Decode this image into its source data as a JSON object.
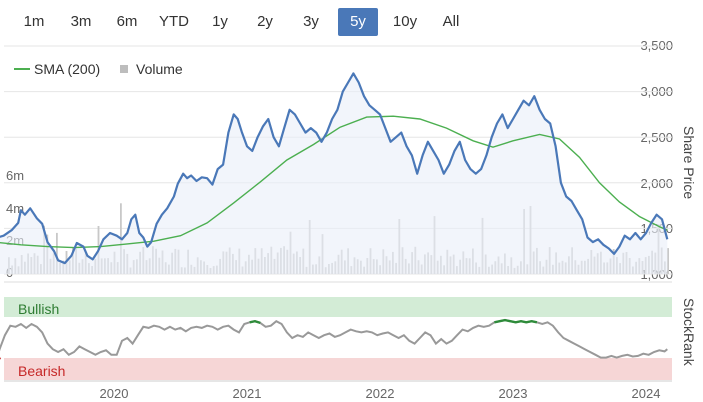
{
  "range_selector": {
    "buttons": [
      "1m",
      "3m",
      "6m",
      "YTD",
      "1y",
      "2y",
      "3y",
      "5y",
      "10y",
      "All"
    ],
    "selected": "5y"
  },
  "colors": {
    "price": "#4a78b8",
    "sma": "#4caf50",
    "volume": "#c8c8c8",
    "bullish_band": "#d3ecd6",
    "bearish_band": "#f6d6d6",
    "stockrank_line": "#999999",
    "stockrank_bull": "#2e8b3a",
    "stockrank_bear": "#c62828"
  },
  "chart_data": {
    "type": "line",
    "legend": [
      "SMA (200)",
      "Volume"
    ],
    "y_right": {
      "title": "Share Price",
      "ticks": [
        "1,000",
        "1,500",
        "2,000",
        "2,500",
        "3,000",
        "3,500"
      ],
      "ylim": [
        1000,
        3500
      ]
    },
    "y_left": {
      "ticks": [
        "0",
        "2m",
        "4m",
        "6m"
      ],
      "ylim": [
        0,
        10
      ]
    },
    "x_ticks": [
      "2020",
      "2021",
      "2022",
      "2023",
      "2024"
    ],
    "series": [
      {
        "name": "",
        "points": [
          [
            2019.1,
            1390
          ],
          [
            2019.17,
            1420
          ],
          [
            2019.23,
            1480
          ],
          [
            2019.28,
            1560
          ],
          [
            2019.3,
            1700
          ],
          [
            2019.33,
            1650
          ],
          [
            2019.37,
            1720
          ],
          [
            2019.42,
            1610
          ],
          [
            2019.46,
            1550
          ],
          [
            2019.5,
            1350
          ],
          [
            2019.55,
            1250
          ],
          [
            2019.58,
            1150
          ],
          [
            2019.63,
            1120
          ],
          [
            2019.68,
            1200
          ],
          [
            2019.72,
            1340
          ],
          [
            2019.77,
            1300
          ],
          [
            2019.8,
            1200
          ],
          [
            2019.84,
            1160
          ],
          [
            2019.88,
            1250
          ],
          [
            2019.92,
            1380
          ],
          [
            2019.97,
            1450
          ],
          [
            2020.02,
            1420
          ],
          [
            2020.06,
            1380
          ],
          [
            2020.1,
            1450
          ],
          [
            2020.13,
            1600
          ],
          [
            2020.16,
            1650
          ],
          [
            2020.19,
            1450
          ],
          [
            2020.22,
            1400
          ],
          [
            2020.25,
            1300
          ],
          [
            2020.28,
            1350
          ],
          [
            2020.32,
            1550
          ],
          [
            2020.36,
            1650
          ],
          [
            2020.4,
            1720
          ],
          [
            2020.45,
            1850
          ],
          [
            2020.48,
            1990
          ],
          [
            2020.52,
            2100
          ],
          [
            2020.55,
            2050
          ],
          [
            2020.58,
            2080
          ],
          [
            2020.62,
            2020
          ],
          [
            2020.66,
            2060
          ],
          [
            2020.7,
            2050
          ],
          [
            2020.74,
            1980
          ],
          [
            2020.78,
            2150
          ],
          [
            2020.82,
            2200
          ],
          [
            2020.86,
            2550
          ],
          [
            2020.9,
            2750
          ],
          [
            2020.93,
            2700
          ],
          [
            2020.96,
            2560
          ],
          [
            2021.0,
            2400
          ],
          [
            2021.04,
            2350
          ],
          [
            2021.08,
            2500
          ],
          [
            2021.12,
            2620
          ],
          [
            2021.16,
            2700
          ],
          [
            2021.2,
            2500
          ],
          [
            2021.24,
            2400
          ],
          [
            2021.28,
            2600
          ],
          [
            2021.32,
            2800
          ],
          [
            2021.36,
            2750
          ],
          [
            2021.4,
            2650
          ],
          [
            2021.44,
            2550
          ],
          [
            2021.48,
            2600
          ],
          [
            2021.52,
            2550
          ],
          [
            2021.56,
            2450
          ],
          [
            2021.6,
            2550
          ],
          [
            2021.64,
            2700
          ],
          [
            2021.68,
            2800
          ],
          [
            2021.72,
            3000
          ],
          [
            2021.76,
            3100
          ],
          [
            2021.8,
            3200
          ],
          [
            2021.84,
            3100
          ],
          [
            2021.88,
            2950
          ],
          [
            2021.92,
            2850
          ],
          [
            2021.96,
            2800
          ],
          [
            2022.0,
            2750
          ],
          [
            2022.04,
            2600
          ],
          [
            2022.08,
            2450
          ],
          [
            2022.12,
            2500
          ],
          [
            2022.16,
            2550
          ],
          [
            2022.2,
            2400
          ],
          [
            2022.24,
            2300
          ],
          [
            2022.28,
            2100
          ],
          [
            2022.32,
            2300
          ],
          [
            2022.36,
            2450
          ],
          [
            2022.4,
            2350
          ],
          [
            2022.44,
            2250
          ],
          [
            2022.48,
            2100
          ],
          [
            2022.52,
            2200
          ],
          [
            2022.56,
            2350
          ],
          [
            2022.6,
            2450
          ],
          [
            2022.64,
            2250
          ],
          [
            2022.68,
            2150
          ],
          [
            2022.72,
            2100
          ],
          [
            2022.76,
            2150
          ],
          [
            2022.8,
            2300
          ],
          [
            2022.84,
            2500
          ],
          [
            2022.88,
            2650
          ],
          [
            2022.92,
            2750
          ],
          [
            2022.96,
            2600
          ],
          [
            2023.0,
            2700
          ],
          [
            2023.04,
            2800
          ],
          [
            2023.08,
            2900
          ],
          [
            2023.12,
            2850
          ],
          [
            2023.16,
            2950
          ],
          [
            2023.2,
            2800
          ],
          [
            2023.24,
            2700
          ],
          [
            2023.28,
            2650
          ],
          [
            2023.32,
            2400
          ],
          [
            2023.36,
            2000
          ],
          [
            2023.4,
            1850
          ],
          [
            2023.44,
            1800
          ],
          [
            2023.48,
            1700
          ],
          [
            2023.52,
            1600
          ],
          [
            2023.56,
            1400
          ],
          [
            2023.6,
            1350
          ],
          [
            2023.64,
            1380
          ],
          [
            2023.68,
            1320
          ],
          [
            2023.72,
            1280
          ],
          [
            2023.76,
            1220
          ],
          [
            2023.8,
            1300
          ],
          [
            2023.84,
            1420
          ],
          [
            2023.88,
            1380
          ],
          [
            2023.92,
            1450
          ],
          [
            2023.96,
            1380
          ],
          [
            2024.0,
            1450
          ],
          [
            2024.04,
            1560
          ],
          [
            2024.08,
            1650
          ],
          [
            2024.12,
            1600
          ],
          [
            2024.16,
            1380
          ]
        ]
      },
      {
        "name": "SMA (200)",
        "points": [
          [
            2019.1,
            1350
          ],
          [
            2019.3,
            1320
          ],
          [
            2019.5,
            1300
          ],
          [
            2019.7,
            1290
          ],
          [
            2019.9,
            1300
          ],
          [
            2020.1,
            1330
          ],
          [
            2020.3,
            1360
          ],
          [
            2020.5,
            1420
          ],
          [
            2020.7,
            1560
          ],
          [
            2020.9,
            1780
          ],
          [
            2021.1,
            2010
          ],
          [
            2021.3,
            2250
          ],
          [
            2021.5,
            2420
          ],
          [
            2021.7,
            2610
          ],
          [
            2021.9,
            2720
          ],
          [
            2022.1,
            2730
          ],
          [
            2022.3,
            2700
          ],
          [
            2022.5,
            2600
          ],
          [
            2022.7,
            2460
          ],
          [
            2022.85,
            2390
          ],
          [
            2023.0,
            2460
          ],
          [
            2023.2,
            2530
          ],
          [
            2023.35,
            2480
          ],
          [
            2023.5,
            2280
          ],
          [
            2023.65,
            2000
          ],
          [
            2023.8,
            1790
          ],
          [
            2023.95,
            1630
          ],
          [
            2024.1,
            1520
          ],
          [
            2024.16,
            1480
          ]
        ]
      }
    ],
    "stockrank": {
      "title": "StockRank",
      "bands": [
        "Bullish",
        "Bearish"
      ],
      "ylim": [
        0,
        100
      ],
      "points": [
        [
          2019.1,
          0
        ],
        [
          2019.14,
          30
        ],
        [
          2019.18,
          55
        ],
        [
          2019.22,
          72
        ],
        [
          2019.26,
          70
        ],
        [
          2019.3,
          75
        ],
        [
          2019.34,
          68
        ],
        [
          2019.38,
          75
        ],
        [
          2019.42,
          70
        ],
        [
          2019.46,
          60
        ],
        [
          2019.5,
          40
        ],
        [
          2019.54,
          30
        ],
        [
          2019.58,
          25
        ],
        [
          2019.62,
          30
        ],
        [
          2019.66,
          20
        ],
        [
          2019.7,
          25
        ],
        [
          2019.74,
          35
        ],
        [
          2019.78,
          30
        ],
        [
          2019.82,
          25
        ],
        [
          2019.86,
          20
        ],
        [
          2019.9,
          25
        ],
        [
          2019.94,
          28
        ],
        [
          2019.98,
          20
        ],
        [
          2020.02,
          20
        ],
        [
          2020.06,
          45
        ],
        [
          2020.1,
          50
        ],
        [
          2020.14,
          40
        ],
        [
          2020.18,
          55
        ],
        [
          2020.22,
          70
        ],
        [
          2020.26,
          68
        ],
        [
          2020.3,
          72
        ],
        [
          2020.34,
          70
        ],
        [
          2020.38,
          65
        ],
        [
          2020.42,
          70
        ],
        [
          2020.46,
          65
        ],
        [
          2020.5,
          68
        ],
        [
          2020.54,
          62
        ],
        [
          2020.58,
          68
        ],
        [
          2020.62,
          70
        ],
        [
          2020.66,
          68
        ],
        [
          2020.7,
          72
        ],
        [
          2020.74,
          70
        ],
        [
          2020.78,
          65
        ],
        [
          2020.82,
          70
        ],
        [
          2020.86,
          72
        ],
        [
          2020.9,
          65
        ],
        [
          2020.94,
          60
        ],
        [
          2020.98,
          75
        ],
        [
          2021.02,
          78
        ],
        [
          2021.06,
          80
        ],
        [
          2021.1,
          77
        ],
        [
          2021.14,
          70
        ],
        [
          2021.18,
          72
        ],
        [
          2021.22,
          80
        ],
        [
          2021.26,
          75
        ],
        [
          2021.3,
          60
        ],
        [
          2021.34,
          50
        ],
        [
          2021.38,
          55
        ],
        [
          2021.42,
          52
        ],
        [
          2021.46,
          60
        ],
        [
          2021.5,
          55
        ],
        [
          2021.54,
          50
        ],
        [
          2021.58,
          55
        ],
        [
          2021.62,
          58
        ],
        [
          2021.66,
          52
        ],
        [
          2021.7,
          55
        ],
        [
          2021.74,
          60
        ],
        [
          2021.78,
          65
        ],
        [
          2021.82,
          62
        ],
        [
          2021.86,
          60
        ],
        [
          2021.9,
          62
        ],
        [
          2021.94,
          60
        ],
        [
          2021.98,
          55
        ],
        [
          2022.02,
          58
        ],
        [
          2022.06,
          60
        ],
        [
          2022.1,
          55
        ],
        [
          2022.14,
          50
        ],
        [
          2022.18,
          55
        ],
        [
          2022.22,
          45
        ],
        [
          2022.26,
          40
        ],
        [
          2022.3,
          50
        ],
        [
          2022.34,
          60
        ],
        [
          2022.38,
          55
        ],
        [
          2022.42,
          40
        ],
        [
          2022.46,
          48
        ],
        [
          2022.5,
          40
        ],
        [
          2022.54,
          45
        ],
        [
          2022.58,
          55
        ],
        [
          2022.62,
          65
        ],
        [
          2022.66,
          62
        ],
        [
          2022.7,
          68
        ],
        [
          2022.74,
          72
        ],
        [
          2022.78,
          70
        ],
        [
          2022.82,
          72
        ],
        [
          2022.86,
          78
        ],
        [
          2022.9,
          80
        ],
        [
          2022.94,
          82
        ],
        [
          2022.98,
          80
        ],
        [
          2023.02,
          78
        ],
        [
          2023.06,
          80
        ],
        [
          2023.1,
          78
        ],
        [
          2023.14,
          80
        ],
        [
          2023.18,
          78
        ],
        [
          2023.22,
          75
        ],
        [
          2023.26,
          78
        ],
        [
          2023.3,
          72
        ],
        [
          2023.34,
          60
        ],
        [
          2023.38,
          50
        ],
        [
          2023.42,
          45
        ],
        [
          2023.46,
          40
        ],
        [
          2023.5,
          35
        ],
        [
          2023.54,
          30
        ],
        [
          2023.58,
          25
        ],
        [
          2023.62,
          20
        ],
        [
          2023.66,
          15
        ],
        [
          2023.7,
          15
        ],
        [
          2023.74,
          18
        ],
        [
          2023.78,
          15
        ],
        [
          2023.82,
          18
        ],
        [
          2023.86,
          20
        ],
        [
          2023.9,
          17
        ],
        [
          2023.94,
          18
        ],
        [
          2023.98,
          22
        ],
        [
          2024.02,
          20
        ],
        [
          2024.06,
          25
        ],
        [
          2024.1,
          28
        ],
        [
          2024.14,
          26
        ],
        [
          2024.16,
          30
        ]
      ]
    }
  }
}
